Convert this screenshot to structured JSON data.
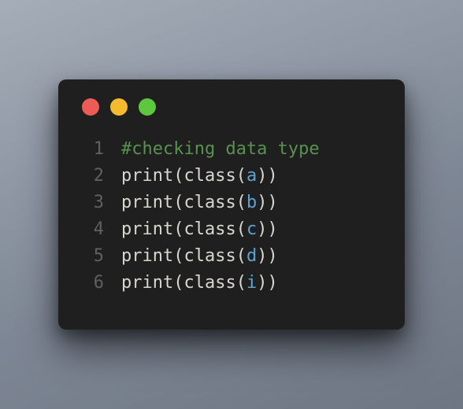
{
  "traffic_lights": {
    "red": "#ec5b56",
    "yellow": "#f3bb2d",
    "green": "#5dc73e"
  },
  "code": {
    "lines": [
      {
        "n": "1",
        "tokens": [
          {
            "t": "#checking data type",
            "c": "tok-comment"
          }
        ]
      },
      {
        "n": "2",
        "tokens": [
          {
            "t": "print",
            "c": "tok-fn"
          },
          {
            "t": "(",
            "c": "tok-punct"
          },
          {
            "t": "class",
            "c": "tok-fn"
          },
          {
            "t": "(",
            "c": "tok-punct"
          },
          {
            "t": "a",
            "c": "tok-var"
          },
          {
            "t": "))",
            "c": "tok-punct"
          }
        ]
      },
      {
        "n": "3",
        "tokens": [
          {
            "t": "print",
            "c": "tok-fn"
          },
          {
            "t": "(",
            "c": "tok-punct"
          },
          {
            "t": "class",
            "c": "tok-fn"
          },
          {
            "t": "(",
            "c": "tok-punct"
          },
          {
            "t": "b",
            "c": "tok-var"
          },
          {
            "t": "))",
            "c": "tok-punct"
          }
        ]
      },
      {
        "n": "4",
        "tokens": [
          {
            "t": "print",
            "c": "tok-fn"
          },
          {
            "t": "(",
            "c": "tok-punct"
          },
          {
            "t": "class",
            "c": "tok-fn"
          },
          {
            "t": "(",
            "c": "tok-punct"
          },
          {
            "t": "c",
            "c": "tok-var"
          },
          {
            "t": "))",
            "c": "tok-punct"
          }
        ]
      },
      {
        "n": "5",
        "tokens": [
          {
            "t": "print",
            "c": "tok-fn"
          },
          {
            "t": "(",
            "c": "tok-punct"
          },
          {
            "t": "class",
            "c": "tok-fn"
          },
          {
            "t": "(",
            "c": "tok-punct"
          },
          {
            "t": "d",
            "c": "tok-var"
          },
          {
            "t": "))",
            "c": "tok-punct"
          }
        ]
      },
      {
        "n": "6",
        "tokens": [
          {
            "t": "print",
            "c": "tok-fn"
          },
          {
            "t": "(",
            "c": "tok-punct"
          },
          {
            "t": "class",
            "c": "tok-fn"
          },
          {
            "t": "(",
            "c": "tok-punct"
          },
          {
            "t": "i",
            "c": "tok-var"
          },
          {
            "t": "))",
            "c": "tok-punct"
          }
        ]
      }
    ]
  }
}
